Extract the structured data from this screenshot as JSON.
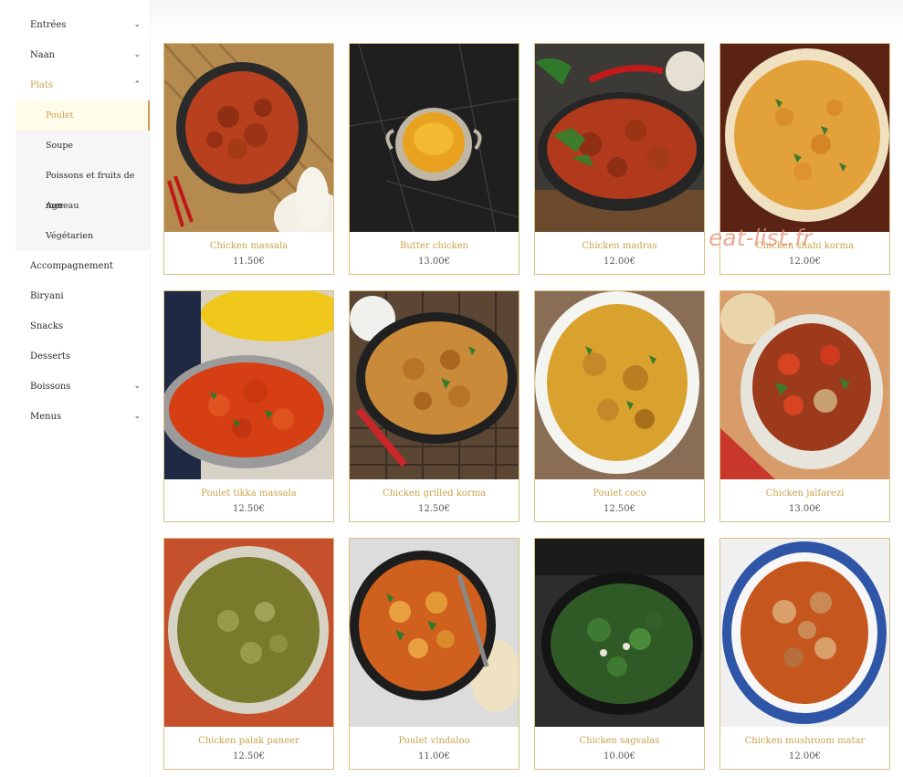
{
  "sidebar": {
    "items": [
      {
        "label": "Entrées",
        "icon": "chevron-down-icon",
        "chev": "⌄"
      },
      {
        "label": "Naan",
        "icon": "chevron-down-icon",
        "chev": "⌄"
      },
      {
        "label": "Plats",
        "icon": "chevron-up-icon",
        "chev": "⌃"
      },
      {
        "label": "Accompagnement"
      },
      {
        "label": "Biryani"
      },
      {
        "label": "Snacks"
      },
      {
        "label": "Desserts"
      },
      {
        "label": "Boissons",
        "icon": "chevron-down-icon",
        "chev": "⌄"
      },
      {
        "label": "Menus",
        "icon": "chevron-down-icon",
        "chev": "⌄"
      }
    ],
    "subitems": [
      {
        "label": "Poulet",
        "active": true
      },
      {
        "label": "Soupe"
      },
      {
        "label": "Poissons et fruits de mer"
      },
      {
        "label": "Agneau"
      },
      {
        "label": "Végétarien"
      }
    ]
  },
  "watermark": "eat-list.fr",
  "colors": {
    "accent": "#c8a24a",
    "card_border": "#d9bf86"
  },
  "products": [
    {
      "name": "Chicken massala",
      "price": "11.50€"
    },
    {
      "name": "Butter chicken",
      "price": "13.00€"
    },
    {
      "name": "Chicken madras",
      "price": "12.00€"
    },
    {
      "name": "Chicken shahi korma",
      "price": "12.00€"
    },
    {
      "name": "Poulet tikka massala",
      "price": "12.50€"
    },
    {
      "name": "Chicken grilled korma",
      "price": "12.50€"
    },
    {
      "name": "Poulet coco",
      "price": "12.50€"
    },
    {
      "name": "Chicken jalfarezi",
      "price": "13.00€"
    },
    {
      "name": "Chicken palak paneer",
      "price": "12.50€"
    },
    {
      "name": "Poulet vindaloo",
      "price": "11.00€"
    },
    {
      "name": "Chicken sagvalas",
      "price": "10.00€"
    },
    {
      "name": "Chicken mushroom matar",
      "price": "12.00€"
    }
  ]
}
